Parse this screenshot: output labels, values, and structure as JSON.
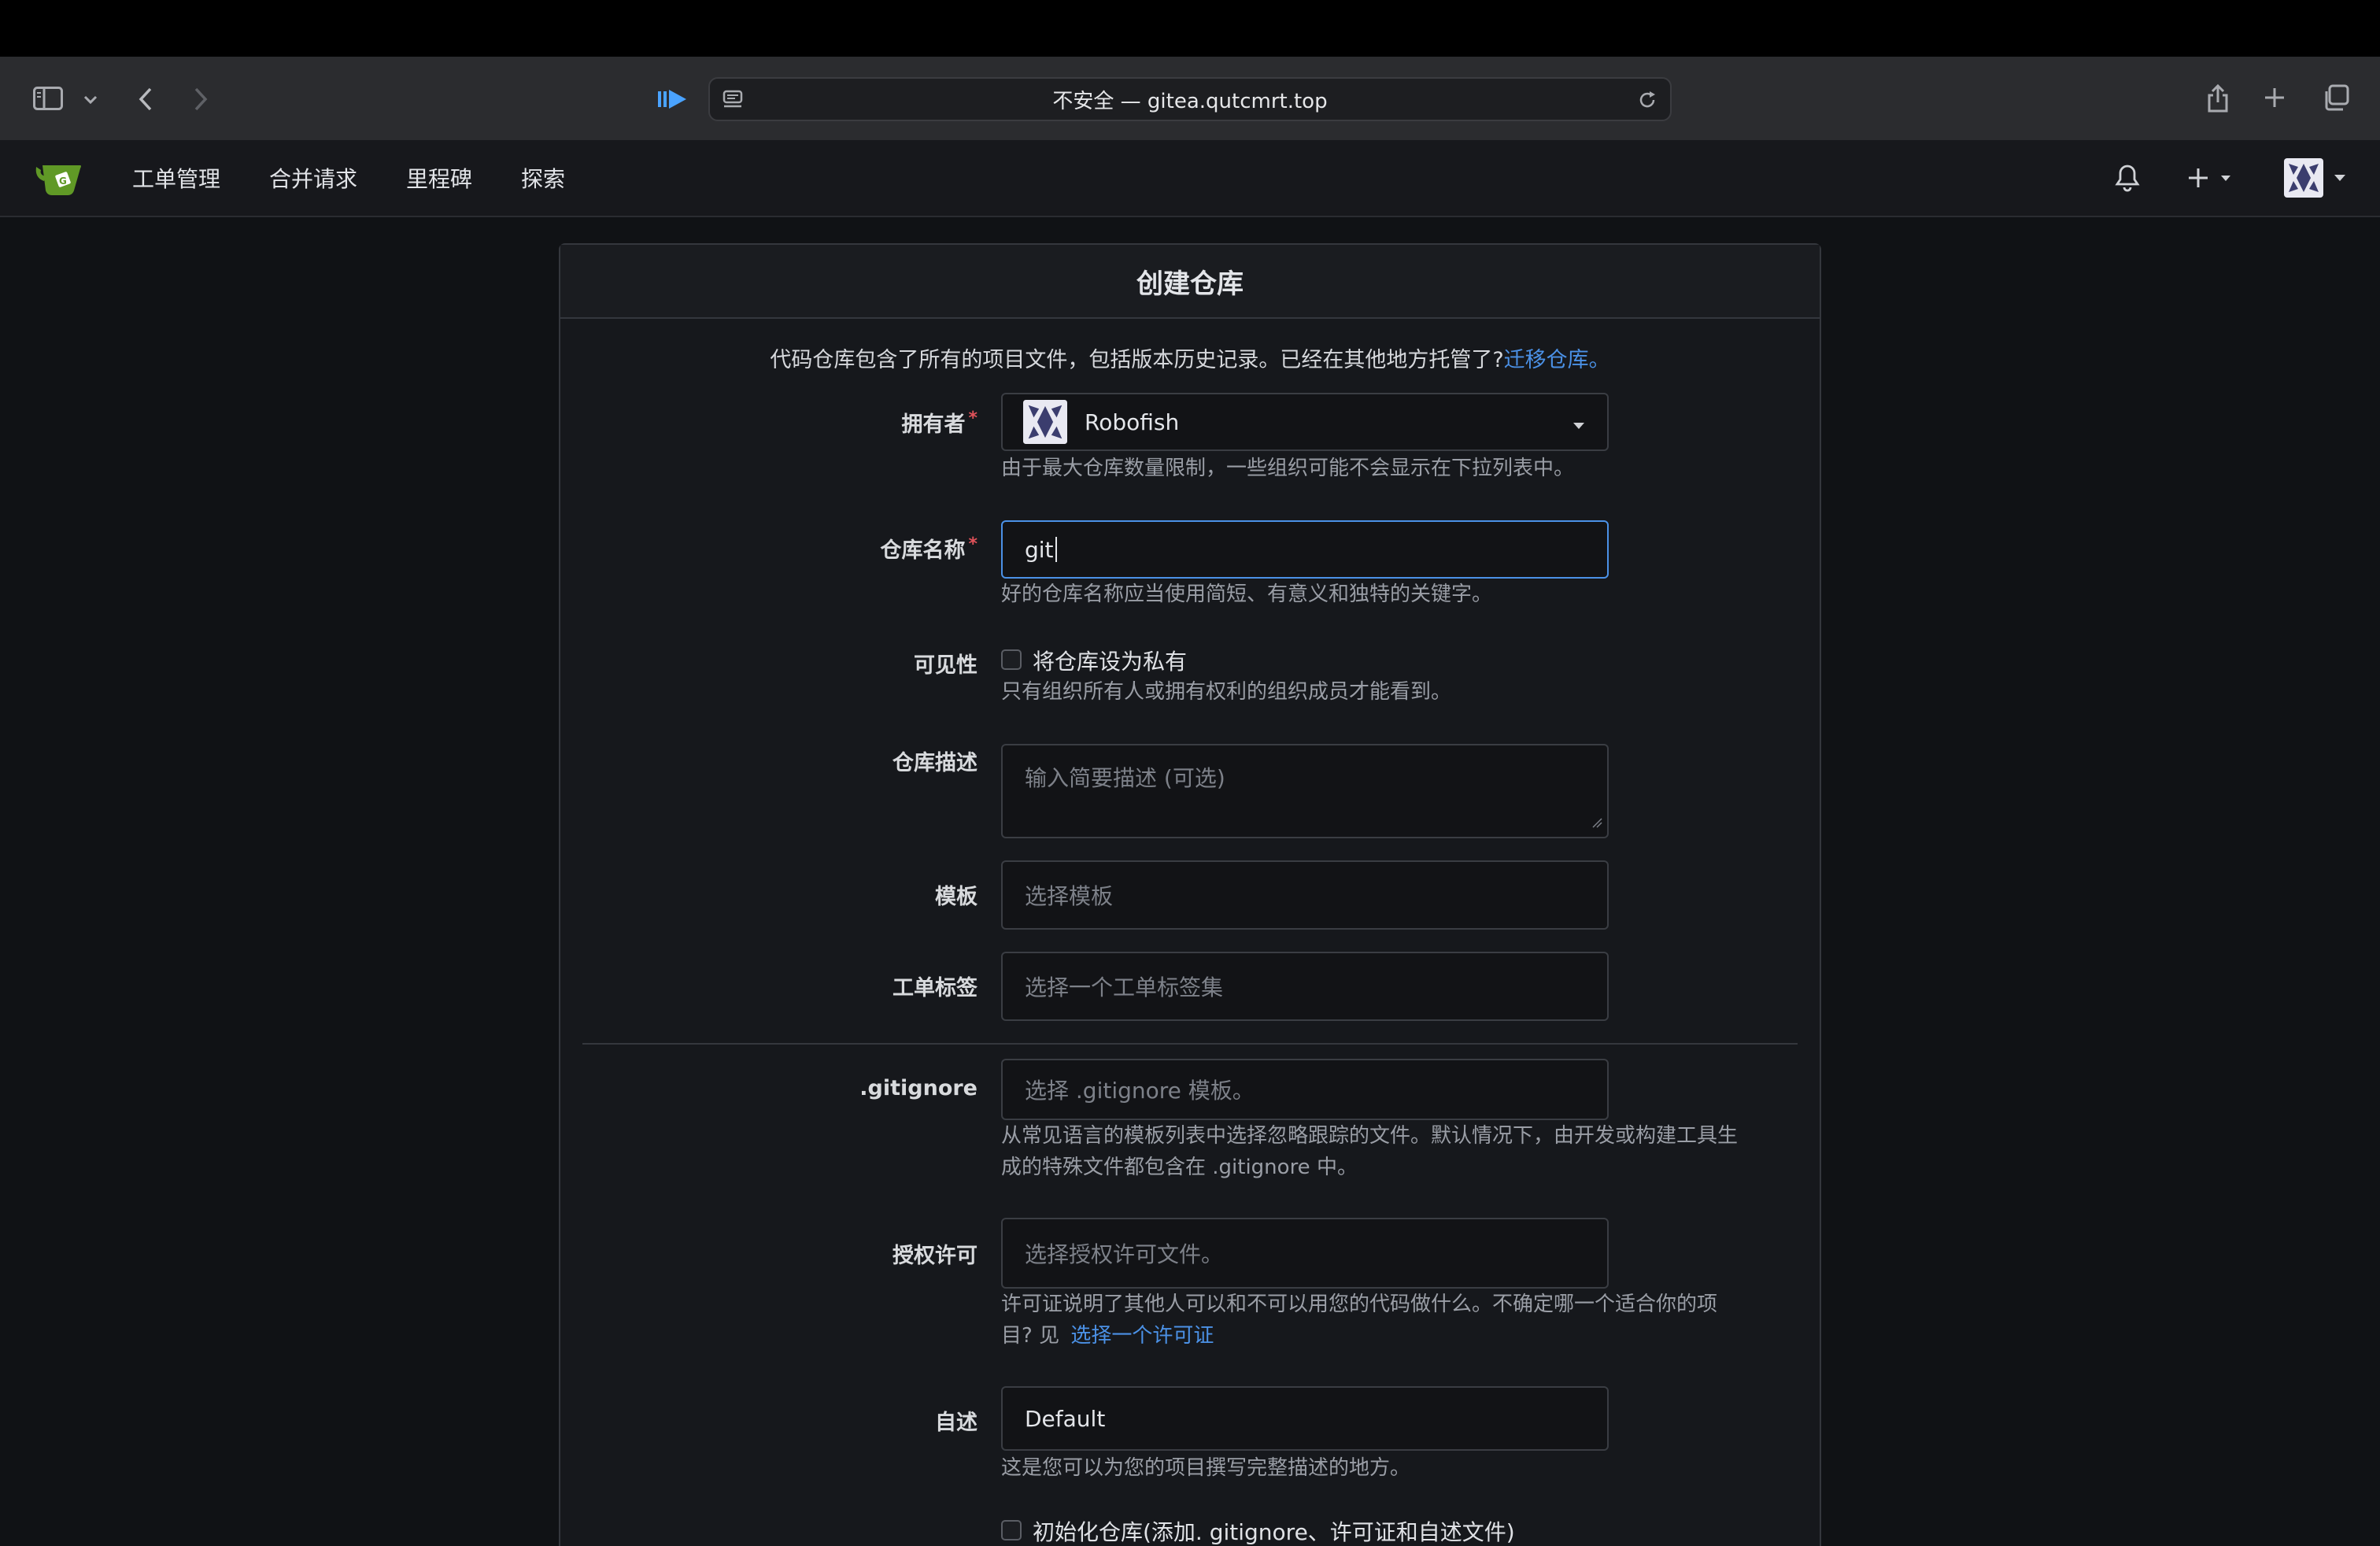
{
  "browser": {
    "address": "不安全 — gitea.qutcmrt.top"
  },
  "nav": {
    "items": [
      "工单管理",
      "合并请求",
      "里程碑",
      "探索"
    ]
  },
  "form": {
    "title": "创建仓库",
    "intro": "代码仓库包含了所有的项目文件，包括版本历史记录。已经在其他地方托管了?",
    "intro_link": "迁移仓库。",
    "owner": {
      "label": "拥有者",
      "value": "Robofish",
      "help": "由于最大仓库数量限制，一些组织可能不会显示在下拉列表中。"
    },
    "repo_name": {
      "label": "仓库名称",
      "value": "git",
      "help": "好的仓库名称应当使用简短、有意义和独特的关键字。"
    },
    "visibility": {
      "label": "可见性",
      "checkbox": "将仓库设为私有",
      "help": "只有组织所有人或拥有权利的组织成员才能看到。"
    },
    "description": {
      "label": "仓库描述",
      "placeholder": "输入简要描述 (可选)"
    },
    "template": {
      "label": "模板",
      "placeholder": "选择模板"
    },
    "issue_labels": {
      "label": "工单标签",
      "placeholder": "选择一个工单标签集"
    },
    "gitignore": {
      "label": ".gitignore",
      "placeholder": "选择 .gitignore 模板。",
      "help_line1": "从常见语言的模板列表中选择忽略跟踪的文件。默认情况下，由开发或构建工具生",
      "help_line2": "成的特殊文件都包含在 .gitignore 中。"
    },
    "license": {
      "label": "授权许可",
      "placeholder": "选择授权许可文件。",
      "help_line1": "许可证说明了其他人可以和不可以用您的代码做什么。不确定哪一个适合你的项",
      "help_line2": "目? 见",
      "help_link": "选择一个许可证"
    },
    "readme": {
      "label": "自述",
      "value": "Default",
      "help": "这是您可以为您的项目撰写完整描述的地方。"
    },
    "init": {
      "checkbox": "初始化仓库(添加. gitignore、许可证和自述文件)"
    }
  }
}
